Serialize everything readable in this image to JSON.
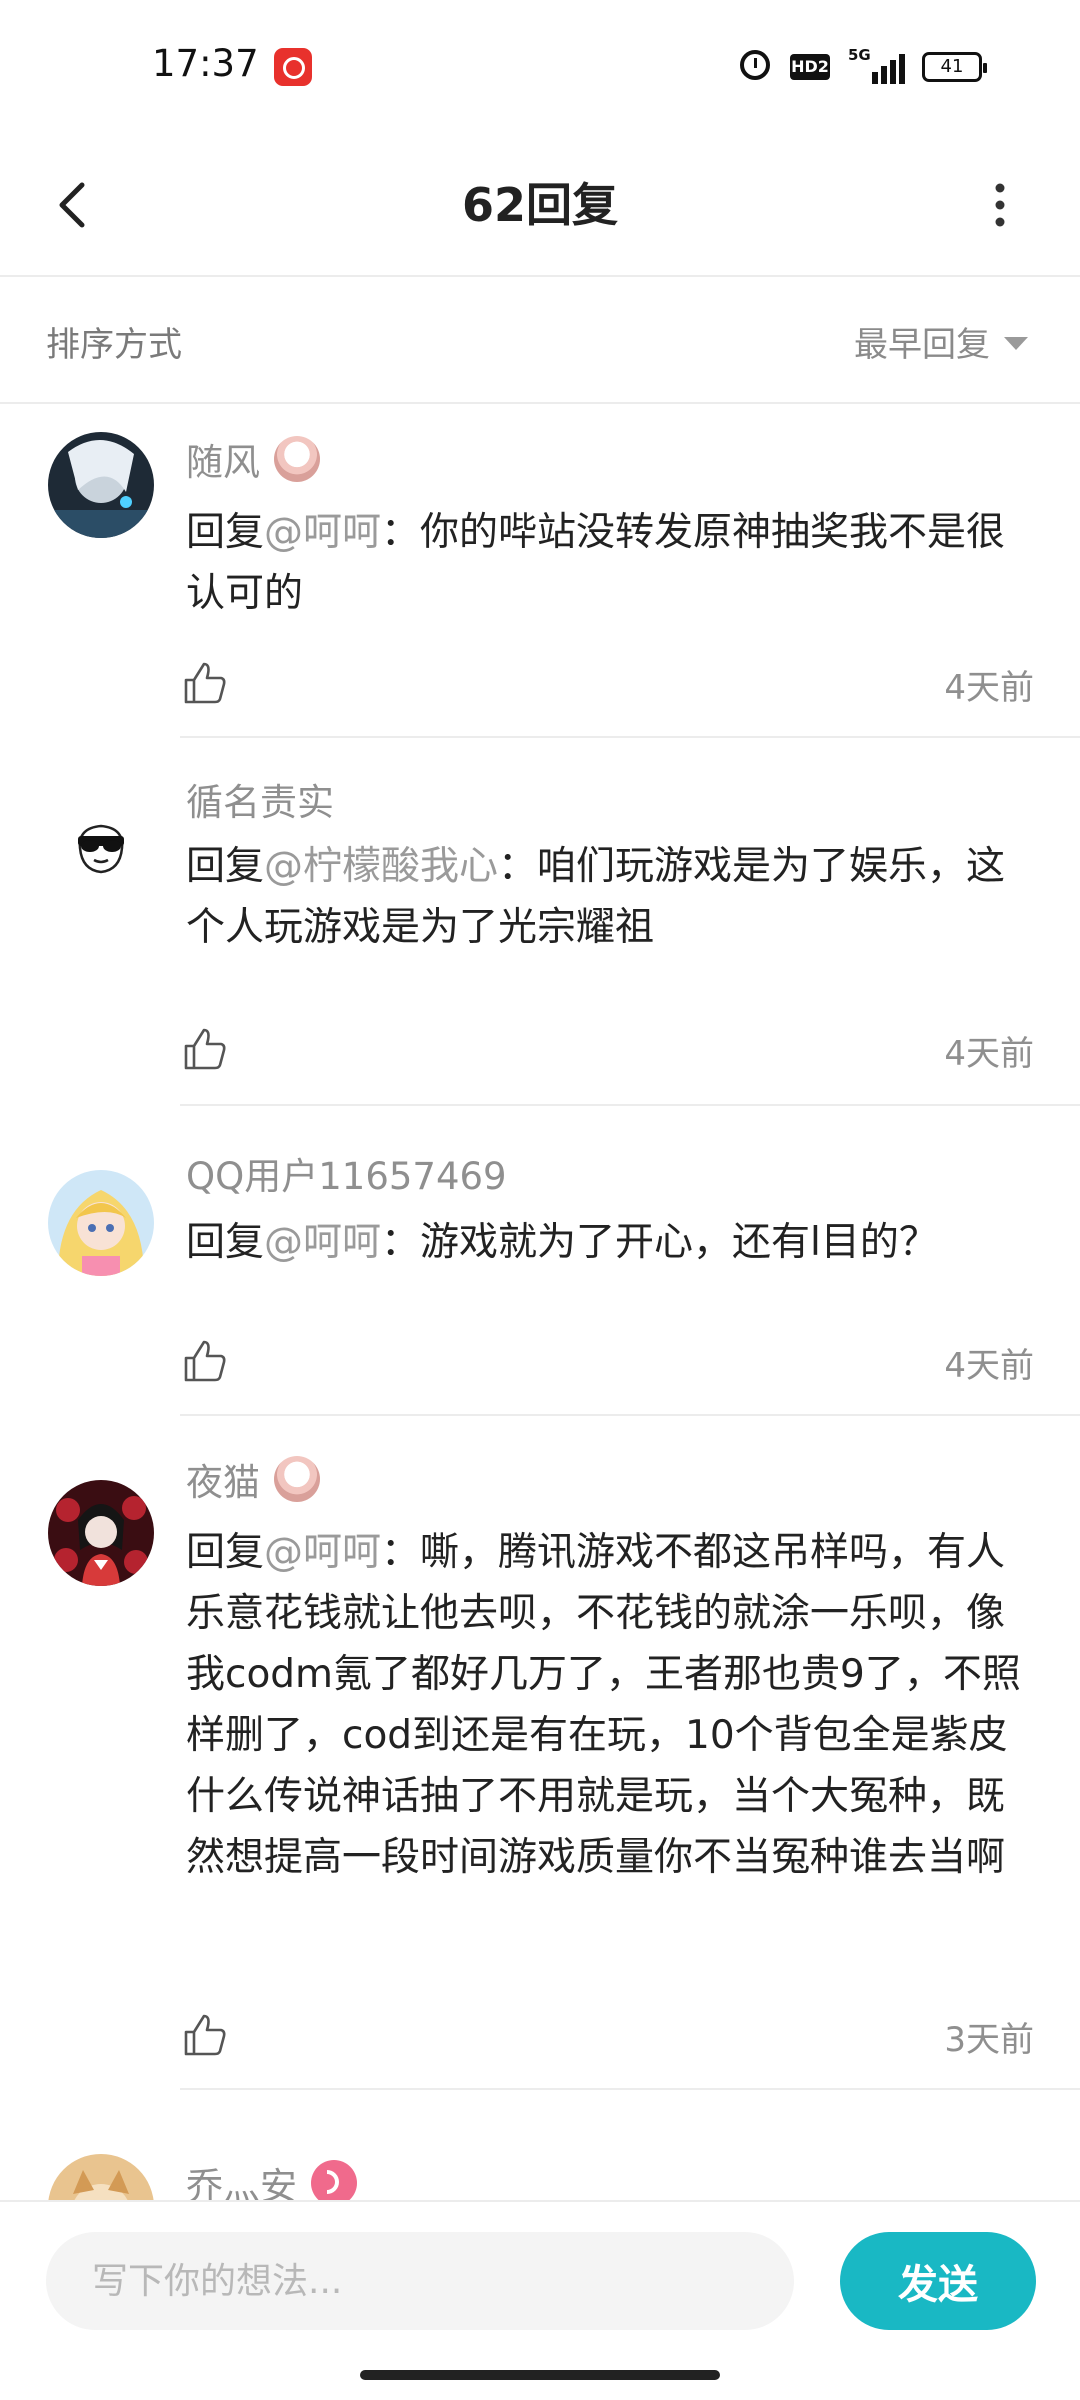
{
  "status_bar": {
    "time": "17:37",
    "hd_label": "HD2",
    "network": "5G",
    "battery": "41",
    "icons": [
      "netease-music-icon",
      "alarm-icon",
      "hd-icon",
      "signal-icon",
      "battery-icon"
    ]
  },
  "header": {
    "title": "62回复"
  },
  "sort": {
    "label": "排序方式",
    "value": "最早回复"
  },
  "comments": [
    {
      "username": "随风",
      "has_badge": true,
      "reply_prefix": "回复",
      "mention": "@呵呵",
      "text": "：你的哔站没转发原神抽奖我不是很认可的",
      "time": "4天前"
    },
    {
      "username": "循名责实",
      "has_badge": false,
      "reply_prefix": "回复",
      "mention": "@柠檬酸我心",
      "text": "：咱们玩游戏是为了娱乐，这个人玩游戏是为了光宗耀祖",
      "time": "4天前"
    },
    {
      "username": "QQ用户11657469",
      "has_badge": false,
      "reply_prefix": "回复",
      "mention": "@呵呵",
      "text": "：游戏就为了开心，还有l目的？",
      "time": "4天前"
    },
    {
      "username": "夜猫",
      "has_badge": true,
      "reply_prefix": "回复",
      "mention": "@呵呵",
      "text": "：嘶，腾讯游戏不都这吊样吗，有人乐意花钱就让他去呗，不花钱的就涂一乐呗，像我codm氪了都好几万了，王者那也贵9了，不照样删了，cod到还是有在玩，10个背包全是紫皮什么传说神话抽了不用就是玩，当个大冤种，既然想提高一段时间游戏质量你不当冤种谁去当啊",
      "time": "3天前"
    },
    {
      "username": "乔灬安",
      "has_badge": true
    }
  ],
  "composer": {
    "placeholder": "写下你的想法...",
    "send_label": "发送"
  },
  "colors": {
    "accent": "#19b8c4",
    "divider": "#ececec",
    "muted_text": "#8f8f8f"
  }
}
